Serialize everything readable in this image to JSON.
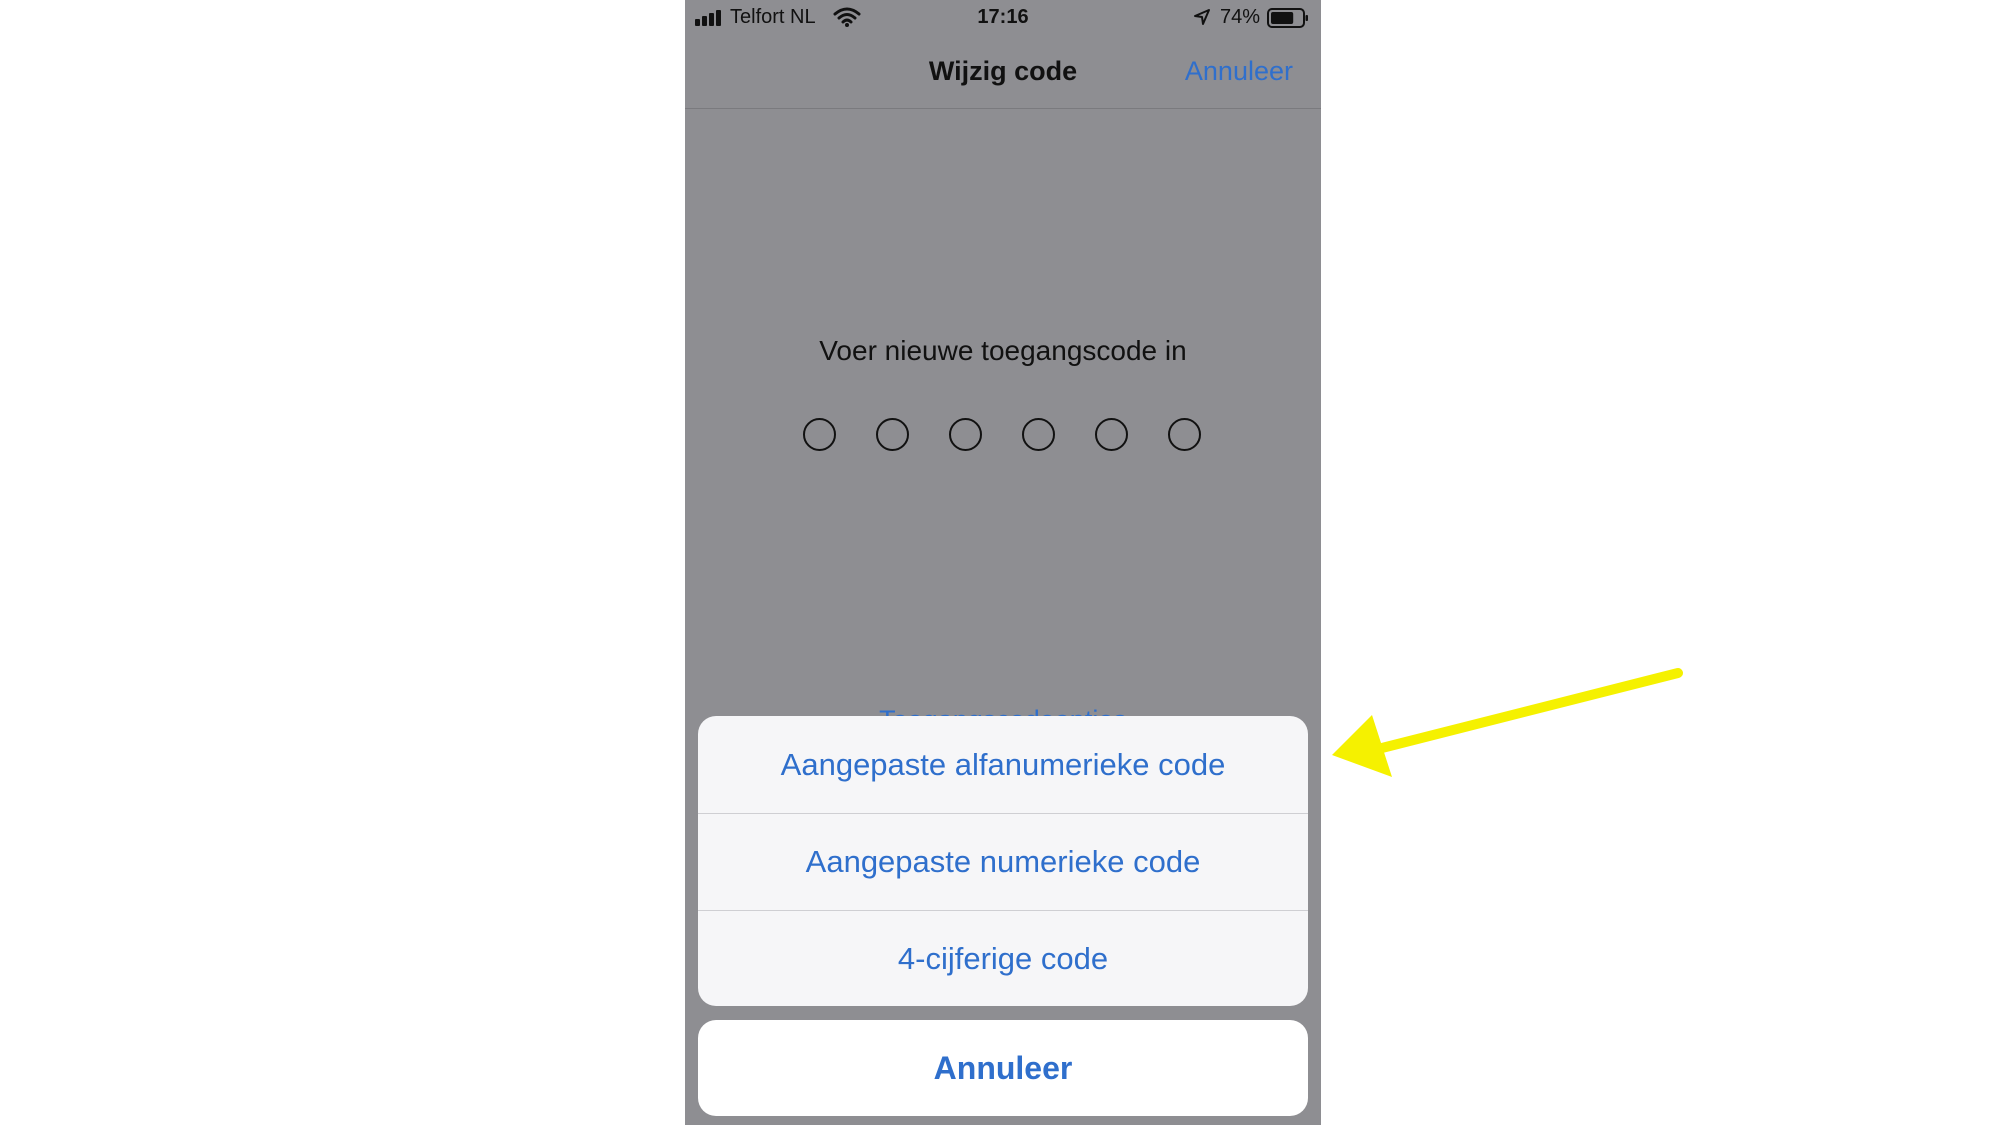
{
  "status_bar": {
    "carrier": "Telfort NL",
    "time": "17:16",
    "battery_percent": "74%",
    "signal_bars": 4,
    "battery_level": 0.74,
    "icons": [
      "signal-icon",
      "wifi-icon",
      "location-arrow-icon",
      "battery-icon"
    ]
  },
  "nav": {
    "title": "Wijzig code",
    "cancel_label": "Annuleer"
  },
  "passcode": {
    "prompt": "Voer nieuwe toegangscode in",
    "digit_count": 6,
    "filled_count": 0
  },
  "options_link": {
    "label": "Toegangscodeopties"
  },
  "action_sheet": {
    "items": [
      {
        "label": "Aangepaste alfanumerieke code"
      },
      {
        "label": "Aangepaste numerieke code"
      },
      {
        "label": "4-cijferige code"
      }
    ],
    "cancel_label": "Annuleer"
  },
  "annotation": {
    "type": "arrow",
    "color": "#f5f100",
    "points_to": "Aangepaste alfanumerieke code"
  },
  "colors": {
    "accent": "#2f6fcc",
    "dimmed_background": "#8e8e92",
    "sheet_background": "#f6f6f8"
  }
}
